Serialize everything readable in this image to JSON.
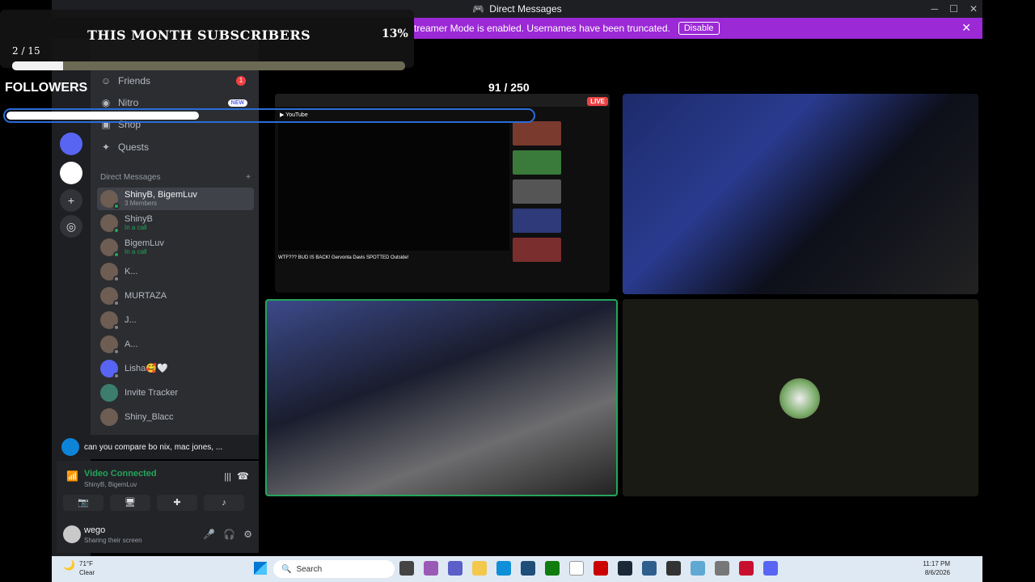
{
  "window": {
    "title": "Direct Messages",
    "controls": [
      "─",
      "☐",
      "✕"
    ]
  },
  "streamer_bar": {
    "text": "Streamer Mode is enabled. Usernames have been truncated.",
    "visible_text": "treamer Mode is enabled. Usernames have been truncated.",
    "disable_label": "Disable"
  },
  "overlay": {
    "subscribers_title": "THIS MONTH SUBSCRIBERS",
    "subscribers_percent": "13%",
    "subscribers_count": "2 / 15",
    "subscribers_progress": 0.13,
    "followers_title": "FOLLOWERS",
    "followers_count": "91 / 250",
    "followers_progress": 0.364
  },
  "nav": {
    "friends": "Friends",
    "friends_badge": "1",
    "nitro": "Nitro",
    "nitro_badge": "NEW",
    "shop": "Shop",
    "quests": "Quests"
  },
  "dm_header": {
    "label": "Direct Messages",
    "add": "+"
  },
  "dms": [
    {
      "name": "ShinyB, BigemLuv",
      "sub": "3 Members",
      "active": true
    },
    {
      "name": "ShinyB",
      "sub": "In a call"
    },
    {
      "name": "BigemLuv",
      "sub": "In a call"
    },
    {
      "name": "K..."
    },
    {
      "name": "MURTAZA"
    },
    {
      "name": "J..."
    },
    {
      "name": "A..."
    },
    {
      "name": "Lisha🥰🤍"
    },
    {
      "name": "Invite Tracker"
    },
    {
      "name": "Shiny_Blacc"
    }
  ],
  "notification": {
    "text": "can you compare bo nix, mac jones, ..."
  },
  "voice": {
    "title": "Video Connected",
    "sub": "ShinyB, BigemLuv"
  },
  "user": {
    "name": "wego",
    "status": "Sharing their screen"
  },
  "stream": {
    "live": "LIVE",
    "yt_caption": "WTF??? BUD IS BACK! Gervonta Davis SPOTTED Outside!"
  },
  "taskbar": {
    "weather_temp": "71°F",
    "weather_cond": "Clear",
    "search": "Search",
    "time": "11:17 PM",
    "date": "8/6/2026"
  },
  "colors": {
    "accent": "#9b29d6",
    "connected": "#23a55a",
    "live": "#ed4245",
    "followers_border": "#2b6cd8"
  }
}
